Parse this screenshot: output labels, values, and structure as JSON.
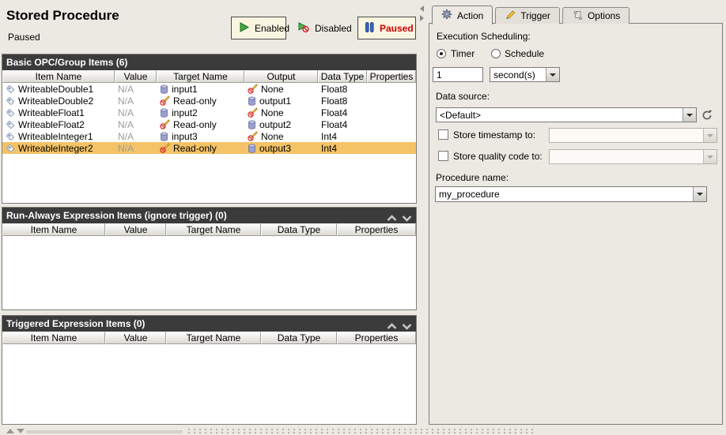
{
  "window": {
    "title": "Stored Procedure",
    "status": "Paused"
  },
  "toolbar": {
    "enabled_label": "Enabled",
    "disabled_label": "Disabled",
    "paused_label": "Paused",
    "active_state": "Paused"
  },
  "colors": {
    "selection_bg": "#F4C367",
    "paused_text": "#CC0000",
    "section_header_bg": "#3B3B3B",
    "state_button_bg": "#FAF5E0",
    "enabled_icon_green": "#44AA44",
    "paused_icon_blue": "#3A66C0"
  },
  "tables": {
    "basic": {
      "title": "Basic OPC/Group Items (6)",
      "columns": [
        "Item Name",
        "Value",
        "Target Name",
        "Output",
        "Data Type",
        "Properties"
      ],
      "rows": [
        {
          "item": "WriteableDouble1",
          "value": "N/A",
          "target": "input1",
          "target_icon": "database",
          "output": "None",
          "output_icon": "no-write",
          "data_type": "Float8",
          "properties": "",
          "selected": false
        },
        {
          "item": "WriteableDouble2",
          "value": "N/A",
          "target": "Read-only",
          "target_icon": "no-write",
          "output": "output1",
          "output_icon": "database",
          "data_type": "Float8",
          "properties": "",
          "selected": false
        },
        {
          "item": "WriteableFloat1",
          "value": "N/A",
          "target": "input2",
          "target_icon": "database",
          "output": "None",
          "output_icon": "no-write",
          "data_type": "Float4",
          "properties": "",
          "selected": false
        },
        {
          "item": "WriteableFloat2",
          "value": "N/A",
          "target": "Read-only",
          "target_icon": "no-write",
          "output": "output2",
          "output_icon": "database",
          "data_type": "Float4",
          "properties": "",
          "selected": false
        },
        {
          "item": "WriteableInteger1",
          "value": "N/A",
          "target": "input3",
          "target_icon": "database",
          "output": "None",
          "output_icon": "no-write",
          "data_type": "Int4",
          "properties": "",
          "selected": false
        },
        {
          "item": "WriteableInteger2",
          "value": "N/A",
          "target": "Read-only",
          "target_icon": "no-write",
          "output": "output3",
          "output_icon": "database",
          "data_type": "Int4",
          "properties": "",
          "selected": true
        }
      ]
    },
    "run_always": {
      "title": "Run-Always Expression Items (ignore trigger) (0)",
      "columns": [
        "Item Name",
        "Value",
        "Target Name",
        "Data Type",
        "Properties"
      ],
      "rows": []
    },
    "triggered": {
      "title": "Triggered Expression Items (0)",
      "columns": [
        "Item Name",
        "Value",
        "Target Name",
        "Data Type",
        "Properties"
      ],
      "rows": []
    }
  },
  "action_panel": {
    "tabs": [
      {
        "label": "Action",
        "icon": "gear-icon"
      },
      {
        "label": "Trigger",
        "icon": "pencil-icon"
      },
      {
        "label": "Options",
        "icon": "script-icon"
      }
    ],
    "active_tab": "Action",
    "execution_scheduling_label": "Execution Scheduling:",
    "timer_label": "Timer",
    "schedule_label": "Schedule",
    "scheduling_mode": "Timer",
    "interval_value": "1",
    "interval_unit": "second(s)",
    "data_source_label": "Data source:",
    "data_source_value": "<Default>",
    "store_timestamp_label": "Store timestamp to:",
    "store_timestamp_checked": false,
    "store_timestamp_value": "",
    "store_quality_label": "Store quality code to:",
    "store_quality_checked": false,
    "store_quality_value": "",
    "procedure_name_label": "Procedure name:",
    "procedure_name_value": "my_procedure"
  }
}
